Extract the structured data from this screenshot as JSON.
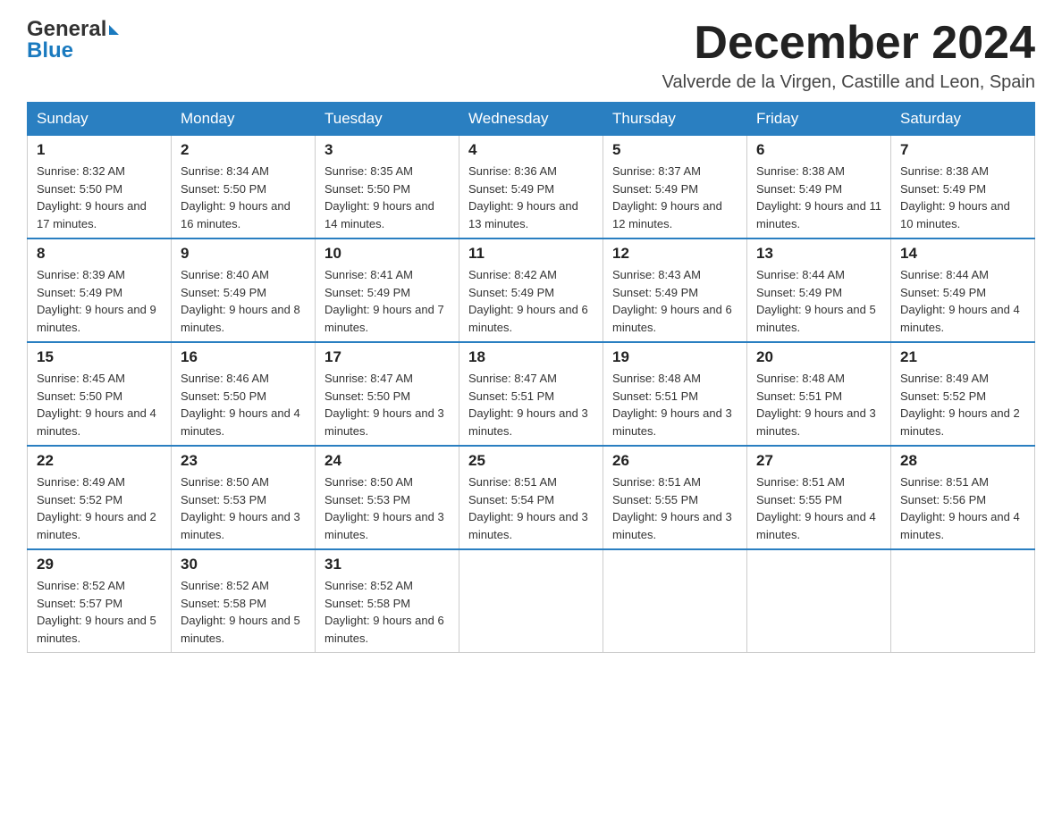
{
  "header": {
    "logo_text_general": "General",
    "logo_text_blue": "Blue",
    "month_title": "December 2024",
    "location": "Valverde de la Virgen, Castille and Leon, Spain"
  },
  "days_of_week": [
    "Sunday",
    "Monday",
    "Tuesday",
    "Wednesday",
    "Thursday",
    "Friday",
    "Saturday"
  ],
  "weeks": [
    [
      {
        "day": "1",
        "sunrise": "8:32 AM",
        "sunset": "5:50 PM",
        "daylight": "9 hours and 17 minutes."
      },
      {
        "day": "2",
        "sunrise": "8:34 AM",
        "sunset": "5:50 PM",
        "daylight": "9 hours and 16 minutes."
      },
      {
        "day": "3",
        "sunrise": "8:35 AM",
        "sunset": "5:50 PM",
        "daylight": "9 hours and 14 minutes."
      },
      {
        "day": "4",
        "sunrise": "8:36 AM",
        "sunset": "5:49 PM",
        "daylight": "9 hours and 13 minutes."
      },
      {
        "day": "5",
        "sunrise": "8:37 AM",
        "sunset": "5:49 PM",
        "daylight": "9 hours and 12 minutes."
      },
      {
        "day": "6",
        "sunrise": "8:38 AM",
        "sunset": "5:49 PM",
        "daylight": "9 hours and 11 minutes."
      },
      {
        "day": "7",
        "sunrise": "8:38 AM",
        "sunset": "5:49 PM",
        "daylight": "9 hours and 10 minutes."
      }
    ],
    [
      {
        "day": "8",
        "sunrise": "8:39 AM",
        "sunset": "5:49 PM",
        "daylight": "9 hours and 9 minutes."
      },
      {
        "day": "9",
        "sunrise": "8:40 AM",
        "sunset": "5:49 PM",
        "daylight": "9 hours and 8 minutes."
      },
      {
        "day": "10",
        "sunrise": "8:41 AM",
        "sunset": "5:49 PM",
        "daylight": "9 hours and 7 minutes."
      },
      {
        "day": "11",
        "sunrise": "8:42 AM",
        "sunset": "5:49 PM",
        "daylight": "9 hours and 6 minutes."
      },
      {
        "day": "12",
        "sunrise": "8:43 AM",
        "sunset": "5:49 PM",
        "daylight": "9 hours and 6 minutes."
      },
      {
        "day": "13",
        "sunrise": "8:44 AM",
        "sunset": "5:49 PM",
        "daylight": "9 hours and 5 minutes."
      },
      {
        "day": "14",
        "sunrise": "8:44 AM",
        "sunset": "5:49 PM",
        "daylight": "9 hours and 4 minutes."
      }
    ],
    [
      {
        "day": "15",
        "sunrise": "8:45 AM",
        "sunset": "5:50 PM",
        "daylight": "9 hours and 4 minutes."
      },
      {
        "day": "16",
        "sunrise": "8:46 AM",
        "sunset": "5:50 PM",
        "daylight": "9 hours and 4 minutes."
      },
      {
        "day": "17",
        "sunrise": "8:47 AM",
        "sunset": "5:50 PM",
        "daylight": "9 hours and 3 minutes."
      },
      {
        "day": "18",
        "sunrise": "8:47 AM",
        "sunset": "5:51 PM",
        "daylight": "9 hours and 3 minutes."
      },
      {
        "day": "19",
        "sunrise": "8:48 AM",
        "sunset": "5:51 PM",
        "daylight": "9 hours and 3 minutes."
      },
      {
        "day": "20",
        "sunrise": "8:48 AM",
        "sunset": "5:51 PM",
        "daylight": "9 hours and 3 minutes."
      },
      {
        "day": "21",
        "sunrise": "8:49 AM",
        "sunset": "5:52 PM",
        "daylight": "9 hours and 2 minutes."
      }
    ],
    [
      {
        "day": "22",
        "sunrise": "8:49 AM",
        "sunset": "5:52 PM",
        "daylight": "9 hours and 2 minutes."
      },
      {
        "day": "23",
        "sunrise": "8:50 AM",
        "sunset": "5:53 PM",
        "daylight": "9 hours and 3 minutes."
      },
      {
        "day": "24",
        "sunrise": "8:50 AM",
        "sunset": "5:53 PM",
        "daylight": "9 hours and 3 minutes."
      },
      {
        "day": "25",
        "sunrise": "8:51 AM",
        "sunset": "5:54 PM",
        "daylight": "9 hours and 3 minutes."
      },
      {
        "day": "26",
        "sunrise": "8:51 AM",
        "sunset": "5:55 PM",
        "daylight": "9 hours and 3 minutes."
      },
      {
        "day": "27",
        "sunrise": "8:51 AM",
        "sunset": "5:55 PM",
        "daylight": "9 hours and 4 minutes."
      },
      {
        "day": "28",
        "sunrise": "8:51 AM",
        "sunset": "5:56 PM",
        "daylight": "9 hours and 4 minutes."
      }
    ],
    [
      {
        "day": "29",
        "sunrise": "8:52 AM",
        "sunset": "5:57 PM",
        "daylight": "9 hours and 5 minutes."
      },
      {
        "day": "30",
        "sunrise": "8:52 AM",
        "sunset": "5:58 PM",
        "daylight": "9 hours and 5 minutes."
      },
      {
        "day": "31",
        "sunrise": "8:52 AM",
        "sunset": "5:58 PM",
        "daylight": "9 hours and 6 minutes."
      },
      null,
      null,
      null,
      null
    ]
  ]
}
